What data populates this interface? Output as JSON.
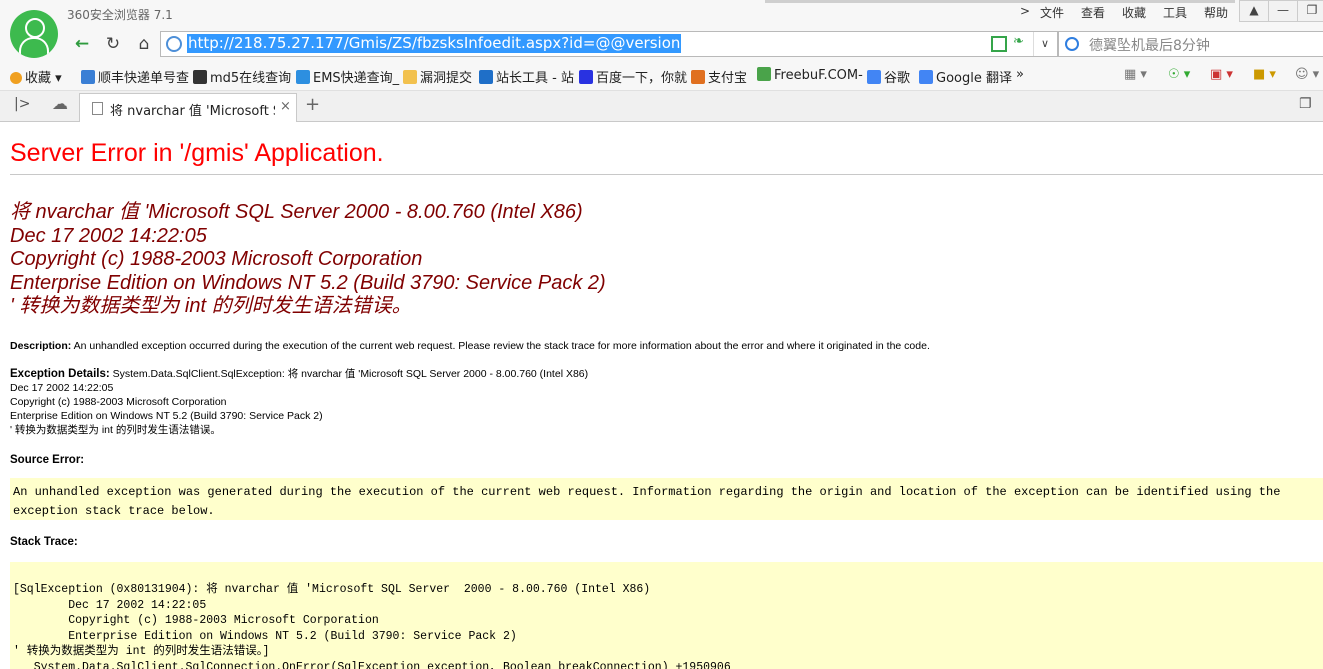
{
  "browser": {
    "app_title": "360安全浏览器 7.1",
    "menu": [
      "文件",
      "查看",
      "收藏",
      "工具",
      "帮助"
    ],
    "menu_prefix": ">",
    "url": "http://218.75.27.177/Gmis/ZS/fbzsksInfoedit.aspx?id=@@version",
    "search_placeholder": "德翼坠机最后8分钟",
    "bookmarks": [
      {
        "label": "收藏",
        "color": "#f0a020"
      },
      {
        "label": "顺丰快递单号查",
        "color": "#3a7fd5"
      },
      {
        "label": "md5在线查询",
        "color": "#333333"
      },
      {
        "label": "EMS快递查询_",
        "color": "#2d8fe0"
      },
      {
        "label": "漏洞提交",
        "color": "#f2c14e"
      },
      {
        "label": "站长工具 - 站",
        "color": "#1f6fc8"
      },
      {
        "label": "百度一下，你就",
        "color": "#2932e1"
      },
      {
        "label": "支付宝",
        "color": "#e07020"
      },
      {
        "label": "FreebuF.COM-",
        "color": "#4aa34a"
      },
      {
        "label": "谷歌",
        "color": "#4285f4"
      },
      {
        "label": "Google 翻译",
        "color": "#4285f4"
      }
    ],
    "bookmarks_more": "»",
    "tab_title": "将 nvarchar 值 'Microsoft SQL",
    "tab_close": "×",
    "new_tab": "+"
  },
  "page": {
    "error_title": "Server Error in '/gmis' Application.",
    "heading_lines": [
      "将 nvarchar 值 'Microsoft SQL Server  2000 - 8.00.760 (Intel X86)",
      "Dec 17 2002 14:22:05",
      "Copyright (c) 1988-2003 Microsoft Corporation",
      "Enterprise Edition on Windows NT 5.2 (Build 3790: Service Pack 2)",
      "' 转换为数据类型为 int 的列时发生语法错误。"
    ],
    "description_label": "Description:",
    "description_text": "An unhandled exception occurred during the execution of the current web request. Please review the stack trace for more information about the error and where it originated in the code.",
    "exception_label": "Exception Details:",
    "exception_lines": [
      "System.Data.SqlClient.SqlException: 将  nvarchar 值  'Microsoft SQL Server  2000 - 8.00.760 (Intel X86)",
      "Dec 17 2002 14:22:05",
      "Copyright (c) 1988-2003 Microsoft Corporation",
      "Enterprise Edition on Windows NT 5.2 (Build 3790: Service Pack 2)",
      "' 转换为数据类型为  int 的列时发生语法错误。"
    ],
    "source_error_label": "Source Error:",
    "source_error_text": "An unhandled exception was generated during the execution of the current web request. Information regarding the origin and location of the exception can be identified using the exception stack trace below.",
    "stack_trace_label": "Stack Trace:",
    "stack_lines": [
      "[SqlException (0x80131904): 将 nvarchar 值 'Microsoft SQL Server  2000 - 8.00.760 (Intel X86)",
      "        Dec 17 2002 14:22:05",
      "        Copyright (c) 1988-2003 Microsoft Corporation",
      "        Enterprise Edition on Windows NT 5.2 (Build 3790: Service Pack 2)",
      "' 转换为数据类型为 int 的列时发生语法错误。]",
      "   System.Data.SqlClient.SqlConnection.OnError(SqlException exception, Boolean breakConnection) +1950906"
    ]
  }
}
